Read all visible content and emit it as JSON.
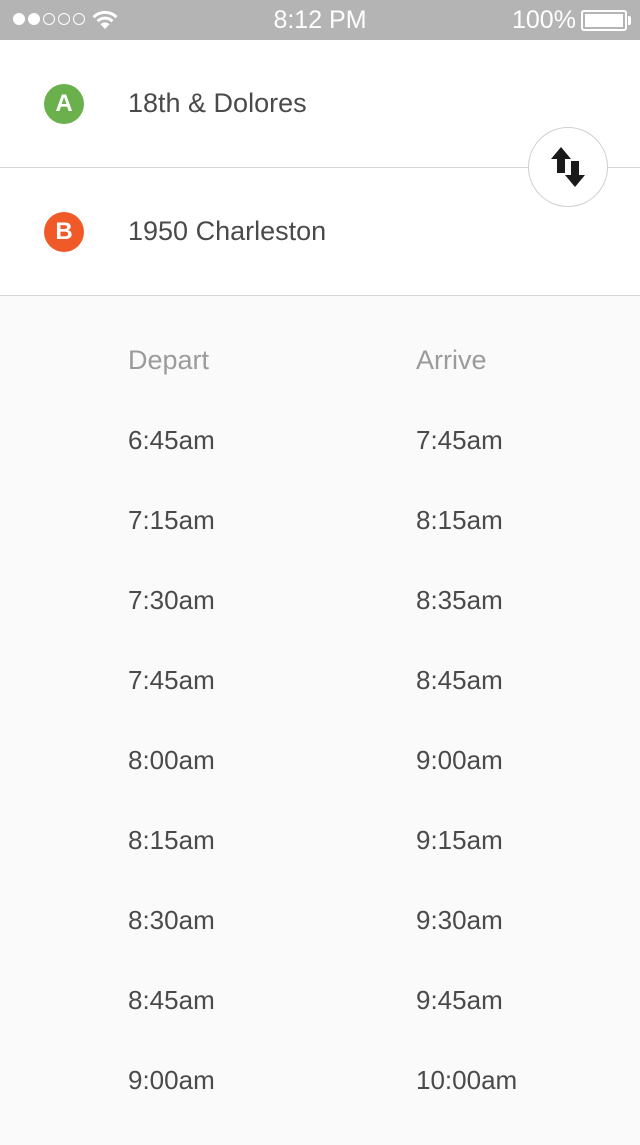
{
  "status_bar": {
    "time": "8:12 PM",
    "battery_percent": "100%",
    "signal_filled": 2,
    "signal_total": 5,
    "battery_level": 1.0
  },
  "route": {
    "origin": {
      "badge": "A",
      "name": "18th & Dolores",
      "color": "#6ab04c"
    },
    "destination": {
      "badge": "B",
      "name": "1950 Charleston",
      "color": "#f05a28"
    },
    "swap_icon": "swap-vertical-arrows-icon"
  },
  "schedule": {
    "depart_header": "Depart",
    "arrive_header": "Arrive",
    "rows": [
      {
        "depart": "6:45am",
        "arrive": "7:45am"
      },
      {
        "depart": "7:15am",
        "arrive": "8:15am"
      },
      {
        "depart": "7:30am",
        "arrive": "8:35am"
      },
      {
        "depart": "7:45am",
        "arrive": "8:45am"
      },
      {
        "depart": "8:00am",
        "arrive": "9:00am"
      },
      {
        "depart": "8:15am",
        "arrive": "9:15am"
      },
      {
        "depart": "8:30am",
        "arrive": "9:30am"
      },
      {
        "depart": "8:45am",
        "arrive": "9:45am"
      },
      {
        "depart": "9:00am",
        "arrive": "10:00am"
      }
    ]
  }
}
